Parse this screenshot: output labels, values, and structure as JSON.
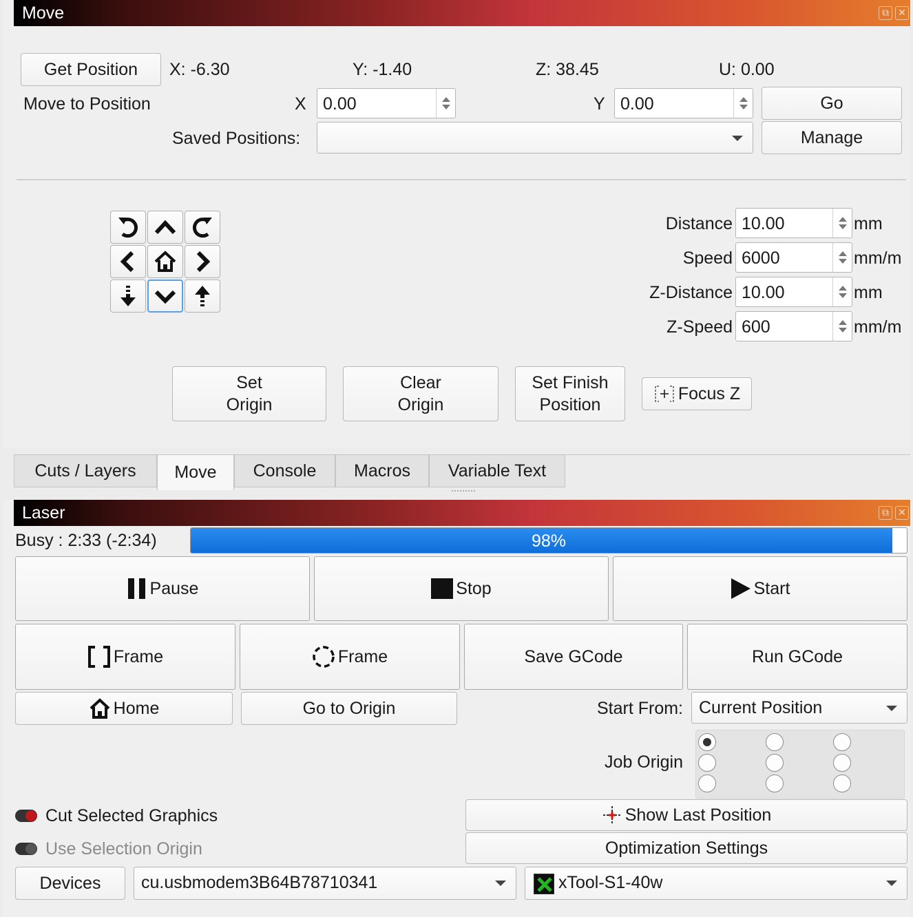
{
  "move_panel": {
    "title": "Move",
    "get_position_label": "Get Position",
    "pos_x": "X: -6.30",
    "pos_y": "Y: -1.40",
    "pos_z": "Z: 38.45",
    "pos_u": "U: 0.00",
    "move_to_position_label": "Move to Position",
    "x_label": "X",
    "x_value": "0.00",
    "y_label": "Y",
    "y_value": "0.00",
    "go_label": "Go",
    "saved_positions_label": "Saved Positions:",
    "saved_positions_value": "",
    "manage_label": "Manage",
    "jog_buttons": [
      "rotate-ccw-icon",
      "arrow-up-icon",
      "rotate-cw-icon",
      "arrow-left-icon",
      "home-icon",
      "arrow-right-icon",
      "z-down-icon",
      "arrow-down-icon",
      "z-up-icon"
    ],
    "params": [
      {
        "label": "Distance",
        "value": "10.00",
        "unit": "mm"
      },
      {
        "label": "Speed",
        "value": "6000",
        "unit": "mm/m"
      },
      {
        "label": "Z-Distance",
        "value": "10.00",
        "unit": "mm"
      },
      {
        "label": "Z-Speed",
        "value": "600",
        "unit": "mm/m"
      }
    ],
    "set_origin_line1": "Set",
    "set_origin_line2": "Origin",
    "clear_origin_line1": "Clear",
    "clear_origin_line2": "Origin",
    "set_finish_line1": "Set Finish",
    "set_finish_line2": "Position",
    "focus_z_label": "Focus Z"
  },
  "tabs": [
    "Cuts / Layers",
    "Move",
    "Console",
    "Macros",
    "Variable Text"
  ],
  "active_tab": "Move",
  "laser_panel": {
    "title": "Laser",
    "status": "Busy : 2:33 (-2:34)",
    "progress_text": "98%",
    "progress_fraction": 0.98,
    "pause_label": "Pause",
    "stop_label": "Stop",
    "start_label": "Start",
    "frame_rect_label": "Frame",
    "frame_circle_label": "Frame",
    "save_gcode_label": "Save GCode",
    "run_gcode_label": "Run GCode",
    "home_label": "Home",
    "go_to_origin_label": "Go to Origin",
    "start_from_label": "Start From:",
    "start_from_value": "Current Position",
    "job_origin_label": "Job Origin",
    "job_origin_selected": "top-left",
    "cut_selected_label": "Cut Selected Graphics",
    "use_selection_origin_label": "Use Selection Origin",
    "show_last_position_label": "Show Last Position",
    "optimization_settings_label": "Optimization Settings",
    "devices_label": "Devices",
    "port_value": "cu.usbmodem3B64B78710341",
    "device_value": "xTool-S1-40w"
  },
  "colors": {
    "progress_blue": "#1577e0",
    "toggle_on": "#c0181a",
    "device_icon_green": "#22b722"
  }
}
